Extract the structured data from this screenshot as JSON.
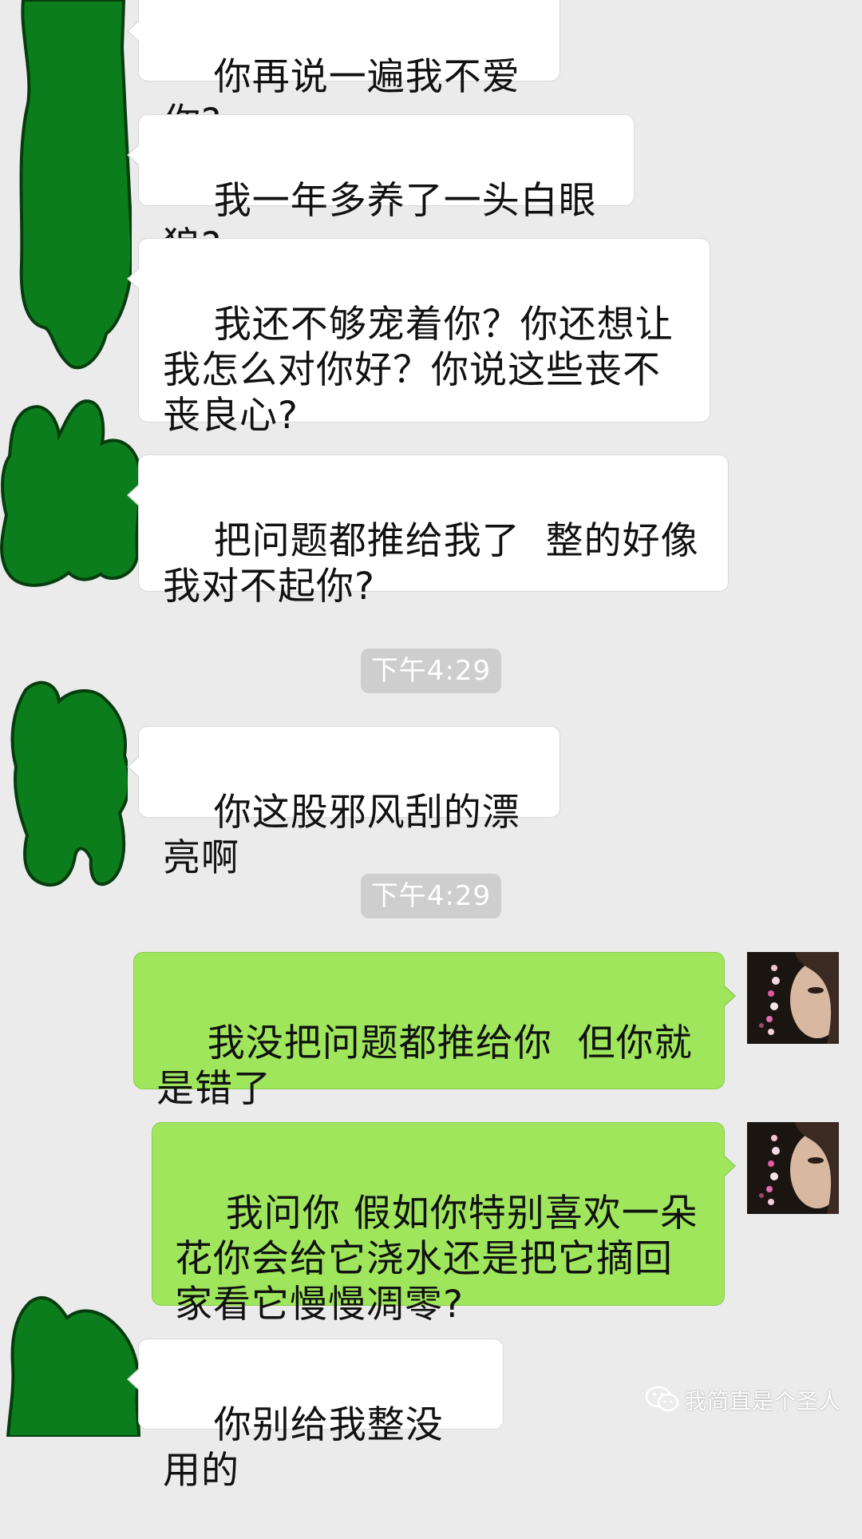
{
  "messages": [
    {
      "direction": "incoming",
      "text": "你再说一遍我不爱你?"
    },
    {
      "direction": "incoming",
      "text": "我一年多养了一头白眼狼?"
    },
    {
      "direction": "incoming",
      "text": "我还不够宠着你？你还想让我怎么对你好？你说这些丧不丧良心?"
    },
    {
      "direction": "incoming",
      "text": "把问题都推给我了  整的好像我对不起你?"
    },
    {
      "direction": "incoming",
      "text": "你这股邪风刮的漂亮啊"
    },
    {
      "direction": "outgoing",
      "text": "我没把问题都推给你  但你就是错了"
    },
    {
      "direction": "outgoing",
      "text": "我问你 假如你特别喜欢一朵花你会给它浇水还是把它摘回家看它慢慢凋零?"
    },
    {
      "direction": "incoming",
      "text": "你别给我整没用的"
    }
  ],
  "timestamps": [
    "下午4:29",
    "下午4:29"
  ],
  "watermark": {
    "icon": "wechat-icon",
    "text": "我简直是个圣人"
  },
  "colors": {
    "background": "#ebebeb",
    "incoming_bubble": "#ffffff",
    "outgoing_bubble": "#9fe65c",
    "timestamp_pill": "#cecece",
    "redaction": "#0b7d1d"
  }
}
